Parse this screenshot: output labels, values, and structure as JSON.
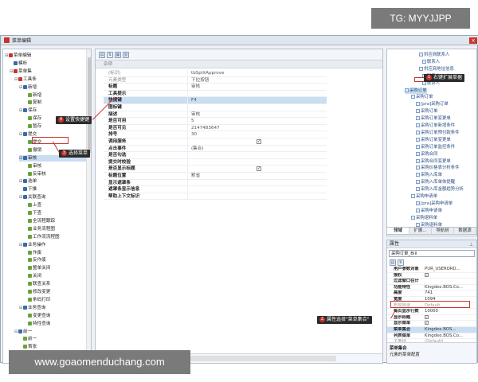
{
  "window": {
    "title": "菜单编辑",
    "close_label": "×"
  },
  "tree": {
    "items": [
      {
        "label": "菜单编辑",
        "toggle": "⊟"
      },
      {
        "label": "模析",
        "toggle": ""
      },
      {
        "label": "菜单集",
        "toggle": "⊟"
      },
      {
        "label": "工具条",
        "toggle": "⊟"
      },
      {
        "label": "新增",
        "toggle": "⊟"
      },
      {
        "label": "新增",
        "toggle": ""
      },
      {
        "label": "复制",
        "toggle": ""
      },
      {
        "label": "保存",
        "toggle": "⊟"
      },
      {
        "label": "保存",
        "toggle": ""
      },
      {
        "label": "暂存",
        "toggle": ""
      },
      {
        "label": "提交",
        "toggle": "⊟"
      },
      {
        "label": "提交",
        "toggle": ""
      },
      {
        "label": "撤销",
        "toggle": ""
      },
      {
        "label": "审核",
        "toggle": "⊟"
      },
      {
        "label": "审核",
        "toggle": ""
      },
      {
        "label": "反审核",
        "toggle": ""
      },
      {
        "label": "选单",
        "toggle": "⊟"
      },
      {
        "label": "下推",
        "toggle": ""
      },
      {
        "label": "关联查询",
        "toggle": "⊟"
      },
      {
        "label": "上查",
        "toggle": ""
      },
      {
        "label": "下查",
        "toggle": ""
      },
      {
        "label": "全流程跟踪",
        "toggle": ""
      },
      {
        "label": "业务流程图",
        "toggle": ""
      },
      {
        "label": "工作流流程图",
        "toggle": ""
      },
      {
        "label": "业务操作",
        "toggle": "⊟"
      },
      {
        "label": "作废",
        "toggle": ""
      },
      {
        "label": "反作废",
        "toggle": ""
      },
      {
        "label": "整单关闭",
        "toggle": ""
      },
      {
        "label": "关闭",
        "toggle": ""
      },
      {
        "label": "联查关系",
        "toggle": ""
      },
      {
        "label": "修改变更",
        "toggle": ""
      },
      {
        "label": "条码打印",
        "toggle": ""
      },
      {
        "label": "业务查询",
        "toggle": "⊟"
      },
      {
        "label": "变更查询",
        "toggle": ""
      },
      {
        "label": "特性查询",
        "toggle": ""
      },
      {
        "label": "前一",
        "toggle": "⊟"
      },
      {
        "label": "前一",
        "toggle": ""
      },
      {
        "label": "首张",
        "toggle": ""
      }
    ]
  },
  "center": {
    "header": "杂项",
    "rows": [
      {
        "key": "(标识)",
        "value": "tbSplitApprove",
        "style": "g",
        "check": ""
      },
      {
        "key": "元素类型",
        "value": "下拉按钮",
        "style": "g",
        "check": ""
      },
      {
        "key": "标题",
        "value": "审核",
        "style": "b",
        "check": ""
      },
      {
        "key": "工具提示",
        "value": "",
        "style": "b",
        "check": ""
      },
      {
        "key": "快捷键",
        "value": "F4",
        "style": "b",
        "check": ""
      },
      {
        "key": "图标键",
        "value": "",
        "style": "b",
        "check": ""
      },
      {
        "key": "描述",
        "value": "审核",
        "style": "b",
        "check": ""
      },
      {
        "key": "是否可用",
        "value": "5",
        "style": "b",
        "check": ""
      },
      {
        "key": "是否可见",
        "value": "2147483647",
        "style": "b",
        "check": ""
      },
      {
        "key": "排号",
        "value": "30",
        "style": "b",
        "check": ""
      },
      {
        "key": "调用服务",
        "value": "",
        "style": "b",
        "check": "✓"
      },
      {
        "key": "点击事件",
        "value": "(集合)",
        "style": "b",
        "check": ""
      },
      {
        "key": "是否勾选",
        "value": "",
        "style": "b",
        "check": ""
      },
      {
        "key": "提交时校验",
        "value": "",
        "style": "b",
        "check": ""
      },
      {
        "key": "是否显示标题",
        "value": "",
        "style": "b",
        "check": "✓"
      },
      {
        "key": "标题位置",
        "value": "默省",
        "style": "b",
        "check": ""
      },
      {
        "key": "显示遮罩条",
        "value": "",
        "style": "b",
        "check": ""
      },
      {
        "key": "遮罩条显示信息",
        "value": "",
        "style": "b",
        "check": ""
      },
      {
        "key": "帮助上下文标识",
        "value": "",
        "style": "b",
        "check": ""
      }
    ]
  },
  "right_tree": {
    "items": [
      {
        "label": "供应商联系人"
      },
      {
        "label": "联系人"
      },
      {
        "label": "供应商地址信息"
      },
      {
        "label": "联系人"
      },
      {
        "label": "联系人"
      },
      {
        "label": "采购订单"
      },
      {
        "label": "采购订单"
      },
      {
        "label": "[pra]采购订单"
      },
      {
        "label": "采购订单"
      },
      {
        "label": "采购订单变更单"
      },
      {
        "label": "采购订单新增条件"
      },
      {
        "label": "采购订单预付款条件"
      },
      {
        "label": "采购订单变更单"
      },
      {
        "label": "采购订单监控条件"
      },
      {
        "label": "采购合同"
      },
      {
        "label": "采购合同变更单"
      },
      {
        "label": "采购价格表分析条件"
      },
      {
        "label": "采购入库单"
      },
      {
        "label": "采购入库单体提醒"
      },
      {
        "label": "采购入库金额趋势分析"
      },
      {
        "label": "采购申请单"
      },
      {
        "label": "[pra]采购申请单"
      },
      {
        "label": "采购申请单"
      },
      {
        "label": "采购退料单"
      },
      {
        "label": "采购退料单"
      }
    ]
  },
  "right_tabs": [
    "领域",
    "扩展...",
    "导航树",
    "数据源"
  ],
  "props": {
    "title": "属性",
    "pin": "⊥",
    "object": "采购订单_Bill",
    "rows": [
      {
        "key": "用户参数对象",
        "value": "PUR_USERORD...",
        "kstyle": "",
        "vstyle": "",
        "check": false
      },
      {
        "key": "授权",
        "value": "",
        "kstyle": "",
        "vstyle": "",
        "check": true
      },
      {
        "key": "过滤窗口往计",
        "value": "",
        "kstyle": "",
        "vstyle": "",
        "check": false
      },
      {
        "key": "功能特性",
        "value": "Kingdee.BOS.Co...",
        "kstyle": "",
        "vstyle": "",
        "check": false
      },
      {
        "key": "高度",
        "value": "741",
        "kstyle": "",
        "vstyle": "",
        "check": false
      },
      {
        "key": "宽度",
        "value": "1094",
        "kstyle": "",
        "vstyle": "",
        "check": false
      },
      {
        "key": "布局目录",
        "value": "Default",
        "kstyle": "g",
        "vstyle": "g",
        "check": false
      },
      {
        "key": "每页显示行数",
        "value": "10000",
        "kstyle": "",
        "vstyle": "",
        "check": false
      },
      {
        "key": "显示标题",
        "value": "",
        "kstyle": "",
        "vstyle": "",
        "check": true
      },
      {
        "key": "显示菜单",
        "value": "",
        "kstyle": "",
        "vstyle": "",
        "check": true
      },
      {
        "key": "菜单集合",
        "value": "Kingdee.BOS... ",
        "kstyle": "",
        "vstyle": "",
        "check": false
      },
      {
        "key": "列表菜单",
        "value": "Kingdee.BOS.Co...",
        "kstyle": "",
        "vstyle": "",
        "check": false
      },
      {
        "key": "子等线",
        "value": "(Default)",
        "kstyle": "g",
        "vstyle": "g",
        "check": false
      }
    ],
    "desc_title": "菜单集合",
    "desc_text": "元素的菜单配置"
  },
  "annotations": {
    "c1": {
      "num": "1",
      "text": "右键扩展单据"
    },
    "c2": {
      "num": "2",
      "text": "属性选择\"菜单集合\""
    },
    "c3": {
      "num": "3",
      "text": "选择菜单"
    },
    "c4": {
      "num": "4",
      "text": "设置快捷键"
    }
  },
  "watermarks": {
    "top": "TG: MYYJJPP",
    "bottom": "www.goaomenduchang.com"
  }
}
